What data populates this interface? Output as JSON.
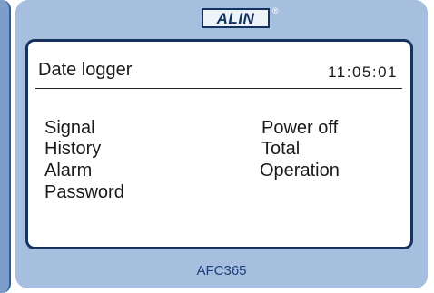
{
  "device": {
    "brand": "ALIN",
    "registered_mark": "®",
    "model": "AFC365"
  },
  "screen": {
    "title": "Date logger",
    "time": "11:05:01"
  },
  "menu": {
    "left": [
      "Signal",
      "History",
      "Alarm",
      "Password"
    ],
    "right": [
      "Power off",
      "Total",
      "Operation"
    ]
  },
  "colors": {
    "bezel": "#a7bfdf",
    "frame": "#17335c",
    "model_text": "#1b3f7a"
  }
}
